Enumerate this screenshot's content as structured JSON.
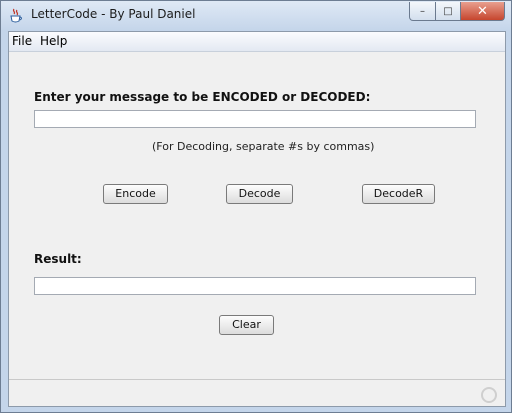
{
  "window": {
    "title": "LetterCode - By Paul Daniel",
    "minimize_glyph": "–",
    "maximize_glyph": "□",
    "close_glyph": "✕"
  },
  "menu": {
    "items": [
      "File",
      "Help"
    ]
  },
  "input": {
    "label": "Enter your message to be ENCODED or DECODED:",
    "value": "",
    "hint": "(For Decoding, separate #s by commas)"
  },
  "buttons": {
    "encode": "Encode",
    "decode": "Decode",
    "decode_r": "DecodeR",
    "clear": "Clear"
  },
  "result": {
    "label": "Result:",
    "value": ""
  },
  "icons": {
    "app": "java-cup-icon",
    "status": "busy-ring-icon"
  },
  "colors": {
    "title_gradient_top": "#dfe9f5",
    "client_background": "#f0f0f0",
    "close_button": "#c6462e"
  }
}
